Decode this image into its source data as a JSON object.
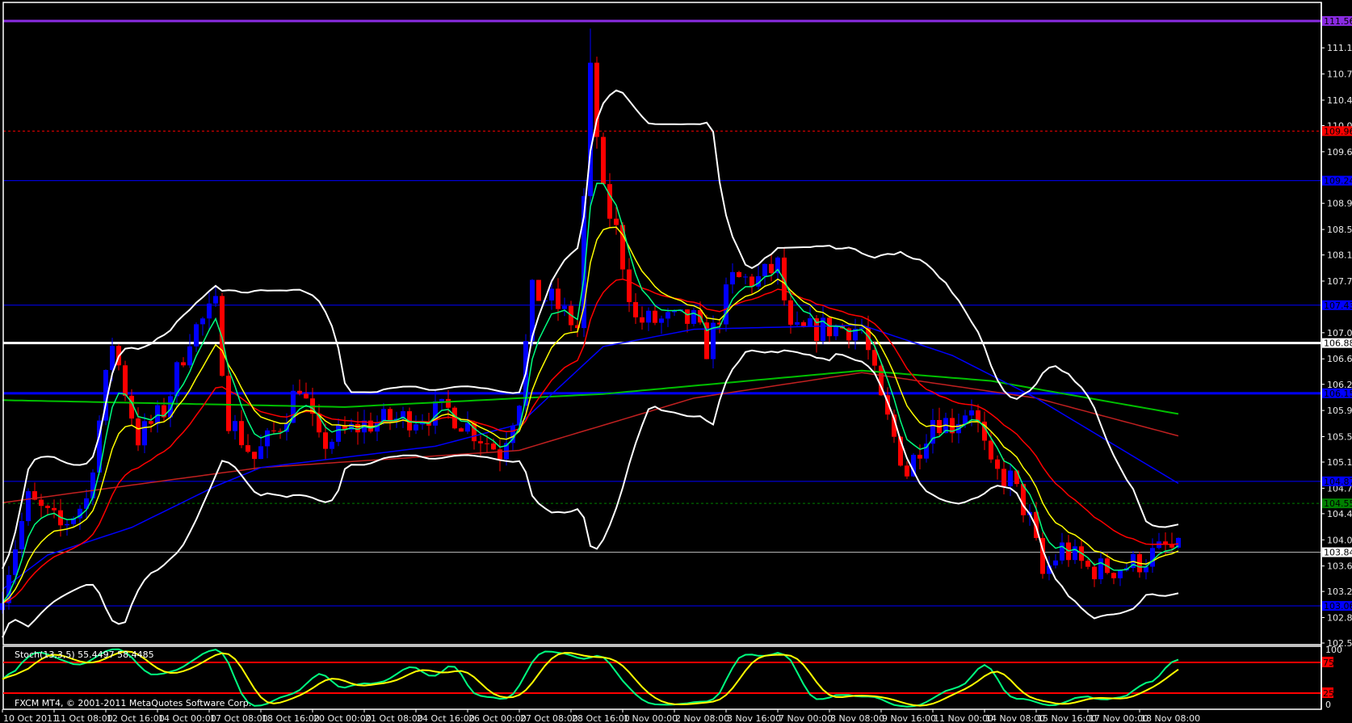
{
  "chart_data": {
    "type": "candlestick",
    "symbol_timeframe": "USDJPY H4",
    "copyright": "FXCM MT4, © 2001-2011 MetaQuotes Software Corp.",
    "ylim": [
      102.52,
      111.56
    ],
    "price_ticks": [
      "111.170",
      "110.790",
      "110.410",
      "110.040",
      "109.660",
      "108.910",
      "108.530",
      "108.160",
      "107.780",
      "107.030",
      "106.650",
      "106.280",
      "105.900",
      "105.520",
      "105.150",
      "104.770",
      "104.400",
      "104.020",
      "103.640",
      "103.270",
      "102.890",
      "102.520"
    ],
    "time_labels": [
      "10 Oct 2011",
      "11 Oct 08:00",
      "12 Oct 16:00",
      "14 Oct 00:00",
      "17 Oct 08:00",
      "18 Oct 16:00",
      "20 Oct 00:00",
      "21 Oct 08:00",
      "24 Oct 16:00",
      "26 Oct 00:00",
      "27 Oct 08:00",
      "28 Oct 16:00",
      "1 Nov 00:00",
      "2 Nov 08:00",
      "3 Nov 16:00",
      "7 Nov 00:00",
      "8 Nov 08:00",
      "9 Nov 16:00",
      "11 Nov 00:00",
      "14 Nov 08:00",
      "15 Nov 16:00",
      "17 Nov 00:00",
      "18 Nov 08:00"
    ],
    "bars_per_label": 8,
    "bar_count": 183,
    "close_anchors": [
      [
        0,
        103.3
      ],
      [
        4,
        104.6
      ],
      [
        9,
        104.2
      ],
      [
        13,
        104.6
      ],
      [
        17,
        106.9
      ],
      [
        21,
        105.5
      ],
      [
        25,
        105.9
      ],
      [
        29,
        107.0
      ],
      [
        33,
        107.4
      ],
      [
        35,
        105.8
      ],
      [
        39,
        105.2
      ],
      [
        43,
        105.7
      ],
      [
        46,
        106.3
      ],
      [
        49,
        105.4
      ],
      [
        56,
        105.7
      ],
      [
        63,
        105.8
      ],
      [
        69,
        105.9
      ],
      [
        77,
        105.3
      ],
      [
        80,
        106.1
      ],
      [
        82,
        107.6
      ],
      [
        85,
        107.5
      ],
      [
        89,
        107.1
      ],
      [
        91,
        110.8
      ],
      [
        93,
        109.0
      ],
      [
        95,
        108.5
      ],
      [
        98,
        107.2
      ],
      [
        101,
        107.2
      ],
      [
        107,
        107.2
      ],
      [
        109,
        106.8
      ],
      [
        113,
        107.8
      ],
      [
        117,
        107.8
      ],
      [
        120,
        108.0
      ],
      [
        122,
        107.0
      ],
      [
        127,
        107.1
      ],
      [
        133,
        107.1
      ],
      [
        136,
        106.0
      ],
      [
        140,
        105.0
      ],
      [
        144,
        105.8
      ],
      [
        147,
        105.7
      ],
      [
        150,
        106.0
      ],
      [
        153,
        105.0
      ],
      [
        156,
        104.9
      ],
      [
        159,
        104.3
      ],
      [
        161,
        103.5
      ],
      [
        164,
        103.9
      ],
      [
        168,
        103.6
      ],
      [
        172,
        103.6
      ],
      [
        176,
        103.7
      ],
      [
        180,
        103.9
      ],
      [
        182,
        103.85
      ]
    ],
    "spike_high": {
      "bar": 91,
      "price": 111.45
    },
    "long_ma_green": [
      [
        0,
        106.05
      ],
      [
        53,
        105.95
      ],
      [
        93,
        106.14
      ],
      [
        133,
        106.48
      ],
      [
        153,
        106.33
      ],
      [
        182,
        105.85
      ]
    ],
    "long_ma_darkred": [
      [
        0,
        104.56
      ],
      [
        40,
        105.07
      ],
      [
        80,
        105.32
      ],
      [
        107,
        106.08
      ],
      [
        133,
        106.45
      ],
      [
        160,
        106.08
      ],
      [
        182,
        105.53
      ]
    ],
    "ma_blue": [
      [
        0,
        103.3
      ],
      [
        7,
        103.8
      ],
      [
        20,
        104.2
      ],
      [
        33,
        104.8
      ],
      [
        40,
        105.07
      ],
      [
        67,
        105.38
      ],
      [
        80,
        105.7
      ],
      [
        93,
        106.83
      ],
      [
        107,
        107.08
      ],
      [
        133,
        107.14
      ],
      [
        147,
        106.7
      ],
      [
        160,
        106.08
      ],
      [
        182,
        104.84
      ]
    ],
    "horizontal_levels": [
      {
        "price": "111.560",
        "value": 111.56,
        "color": "#8a2be2",
        "style": "solid-thick"
      },
      {
        "price": "109.960",
        "value": 109.96,
        "color": "#ff0000",
        "style": "dashed"
      },
      {
        "price": "109.240",
        "value": 109.24,
        "color": "#0000ff",
        "style": "solid"
      },
      {
        "price": "107.430",
        "value": 107.43,
        "color": "#0000ff",
        "style": "solid"
      },
      {
        "price": "106.880",
        "value": 106.88,
        "color": "#ffffff",
        "style": "solid-thick"
      },
      {
        "price": "106.150",
        "value": 106.15,
        "color": "#0000ff",
        "style": "solid-thick"
      },
      {
        "price": "104.870",
        "value": 104.87,
        "color": "#0000ff",
        "style": "solid"
      },
      {
        "price": "104.550",
        "value": 104.55,
        "color": "#008000",
        "style": "dashed"
      },
      {
        "price": "103.840",
        "value": 103.84,
        "color": "#c0c0c0",
        "style": "solid"
      },
      {
        "price": "103.060",
        "value": 103.06,
        "color": "#0000ff",
        "style": "solid"
      }
    ],
    "stochastic": {
      "label": "Stoch(13,3,5) 55.4497 58.4485",
      "levels": [
        "75",
        "25"
      ],
      "axis": [
        "100",
        "0"
      ],
      "main_value": 55.4497,
      "signal_value": 58.4485
    },
    "colors": {
      "bull": "#0000ff",
      "bear": "#ff0000",
      "ema_fast": "#00ff80",
      "ema_mid": "#ffff00",
      "ema_slow": "#ff0000",
      "ma_blue": "#0000ff",
      "ma_green": "#00c000",
      "ma_darkred": "#c02020",
      "bands": "#ffffff",
      "grid": "#ffffff"
    }
  }
}
